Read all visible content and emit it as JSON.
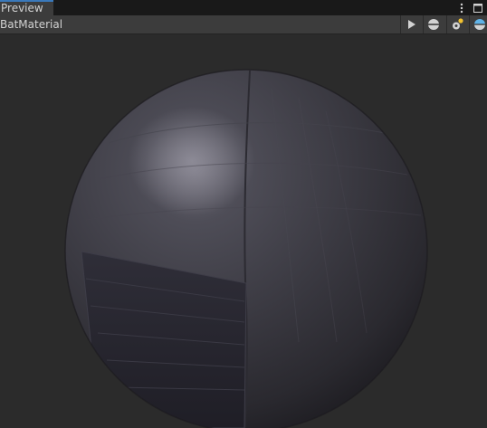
{
  "tab": {
    "title": "Preview"
  },
  "toolbar": {
    "material_name": "BatMaterial",
    "buttons": [
      {
        "name": "play-preview",
        "icon": "play-icon"
      },
      {
        "name": "preview-mesh",
        "icon": "sphere-icon"
      },
      {
        "name": "preview-lighting",
        "icon": "light-icon"
      },
      {
        "name": "preview-background",
        "icon": "background-sphere-icon"
      }
    ]
  },
  "colors": {
    "accent": "#3a79bb",
    "toolbar": "#3c3c3c",
    "viewport": "#2b2b2b",
    "sphere_base": "#3b3a42"
  }
}
